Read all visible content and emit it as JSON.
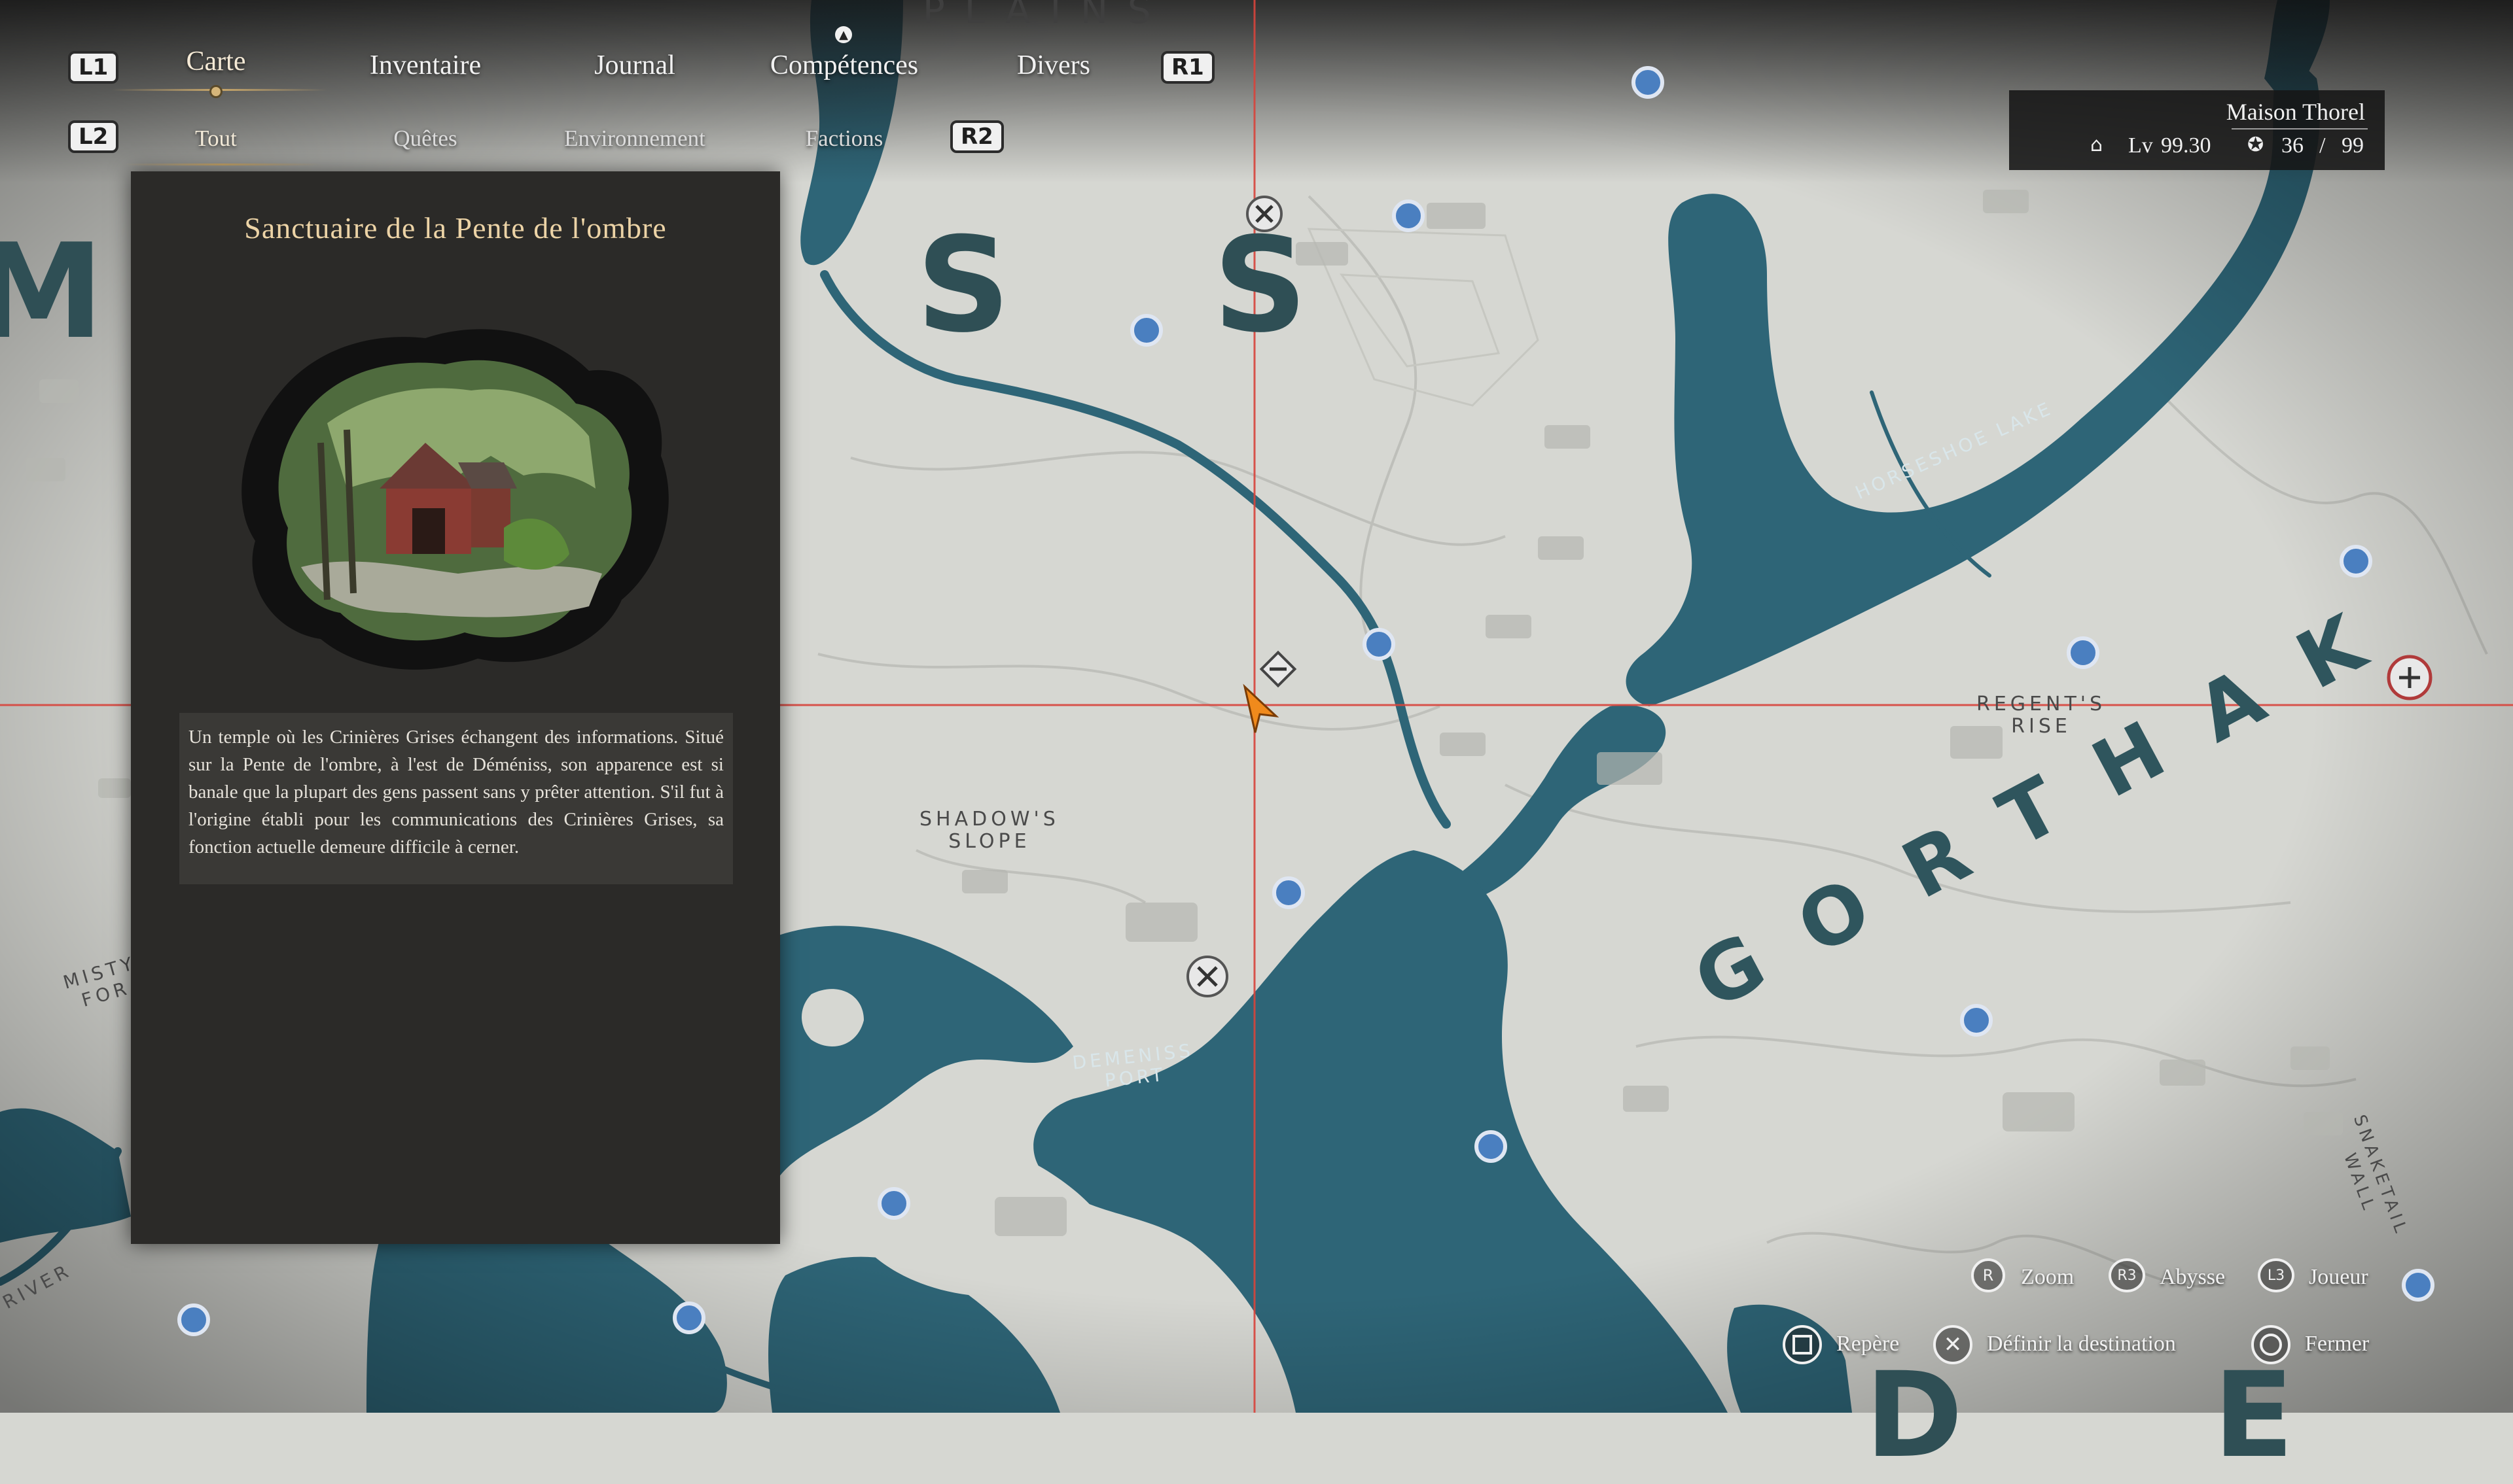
{
  "colors": {
    "land": "#d6d7d2",
    "water": "#2e6577",
    "panel": "#2b2a28",
    "accent_gold": "#c9a76a",
    "crosshair": "#d8443c",
    "player_marker": "#f08a1c",
    "waypoint_blue": "#4a7fc0"
  },
  "nav": {
    "l1": "L1",
    "r1": "R1",
    "l2": "L2",
    "r2": "R2",
    "tabs": [
      "Carte",
      "Inventaire",
      "Journal",
      "Compétences",
      "Divers"
    ],
    "active_tab": "Carte",
    "subtabs": [
      "Tout",
      "Quêtes",
      "Environnement",
      "Factions"
    ],
    "active_subtab": "Tout"
  },
  "panel": {
    "title": "Sanctuaire de la Pente de l'ombre",
    "description": "Un temple où les Crinières Grises échangent des informations. Situé sur la Pente de l'ombre, à l'est de Déméniss, son apparence est si banale que la plupart des gens passent sans y prêter attention. S'il fut à l'origine établi pour les communications des Crinières Grises, sa fonction actuelle demeure difficile à cerner."
  },
  "player": {
    "name": "Maison Thorel",
    "level_label": "Lv",
    "level": "99.30",
    "abyss_count": "36",
    "abyss_sep": "/",
    "abyss_max": "99"
  },
  "controls": {
    "zoom_btn": "R",
    "zoom": "Zoom",
    "abyss_btn": "R3",
    "abyss": "Abysse",
    "player_btn": "L3",
    "player": "Joueur",
    "marker": "Repère",
    "set_destination": "Définir la destination",
    "close": "Fermer"
  },
  "map_labels": {
    "plains": "PLAINS",
    "region_fragment_top": "S S",
    "region_fragment_left": "M",
    "horseshoe_lake": "HORSESHOE LAKE",
    "regents_rise": "REGENT'S\nRISE",
    "shadows_slope": "SHADOW'S\nSLOPE",
    "demeniss_port": "DEMENISS\nPORT",
    "gorthak": "GORTHAK",
    "snaketail_wall": "SNAKETAIL\nWALL",
    "misty_fragment": "MISTY\nFOR",
    "river_fragment": "RIVER",
    "bottom_fragment": "D E"
  },
  "icons": {
    "player_marker": "arrow-cursor-icon",
    "shrine": "shrine-icon",
    "waypoint": "waypoint-icon",
    "faction": "faction-crest-icon"
  }
}
